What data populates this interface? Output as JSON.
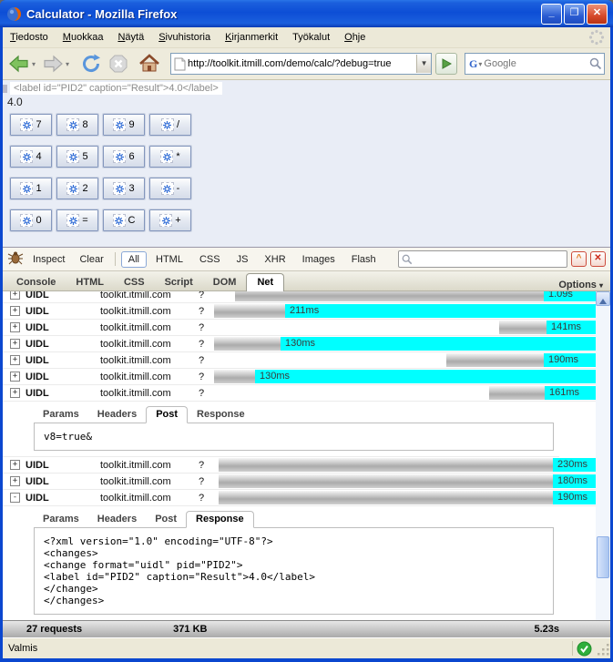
{
  "window": {
    "title": "Calculator - Mozilla Firefox"
  },
  "titlebar_buttons": {
    "minimize": "_",
    "maximize": "□",
    "close": "✕"
  },
  "menu": {
    "items": [
      {
        "label": "Tiedosto",
        "u": "T"
      },
      {
        "label": "Muokkaa",
        "u": "M"
      },
      {
        "label": "Näytä",
        "u": "N"
      },
      {
        "label": "Sivuhistoria",
        "u": "S"
      },
      {
        "label": "Kirjanmerkit",
        "u": "K"
      },
      {
        "label": "Työkalut",
        "u": ""
      },
      {
        "label": "Ohje",
        "u": "O"
      }
    ]
  },
  "toolbar": {
    "url": "http://toolkit.itmill.com/demo/calc/?debug=true",
    "search_placeholder": "Google",
    "search_engine": "G"
  },
  "page": {
    "debug_line": "<label id=\"PID2\" caption=\"Result\">4.0</label>",
    "result": "4.0",
    "calc_buttons": [
      "7",
      "8",
      "9",
      "/",
      "4",
      "5",
      "6",
      "*",
      "1",
      "2",
      "3",
      "-",
      "0",
      "=",
      "C",
      "+"
    ]
  },
  "firebug": {
    "toolbar": {
      "inspect": "Inspect",
      "clear": "Clear",
      "filters": [
        "All",
        "HTML",
        "CSS",
        "JS",
        "XHR",
        "Images",
        "Flash"
      ],
      "active_filter": "All"
    },
    "tabs": [
      "Console",
      "HTML",
      "CSS",
      "Script",
      "DOM",
      "Net"
    ],
    "active_tab": "Net",
    "options_label": "Options",
    "net": {
      "timeline_width": 419,
      "sections": [
        {
          "type": "row",
          "clipped": true,
          "expander": "+",
          "name": "UIDL",
          "domain": "toolkit.itmill.com",
          "path": "?",
          "time": "1.09s",
          "gray_start": 23,
          "gray_end": 362
        },
        {
          "type": "row",
          "expander": "+",
          "name": "UIDL",
          "domain": "toolkit.itmill.com",
          "path": "?",
          "time": "211ms",
          "gray_start": 0,
          "gray_end": 78
        },
        {
          "type": "row",
          "expander": "+",
          "name": "UIDL",
          "domain": "toolkit.itmill.com",
          "path": "?",
          "time": "141ms",
          "gray_start": 313,
          "gray_end": 365
        },
        {
          "type": "row",
          "expander": "+",
          "name": "UIDL",
          "domain": "toolkit.itmill.com",
          "path": "?",
          "time": "130ms",
          "gray_start": 0,
          "gray_end": 73
        },
        {
          "type": "row",
          "expander": "+",
          "name": "UIDL",
          "domain": "toolkit.itmill.com",
          "path": "?",
          "time": "190ms",
          "gray_start": 255,
          "gray_end": 362
        },
        {
          "type": "row",
          "expander": "+",
          "name": "UIDL",
          "domain": "toolkit.itmill.com",
          "path": "?",
          "time": "130ms",
          "gray_start": 0,
          "gray_end": 45
        },
        {
          "type": "row",
          "expander": "+",
          "name": "UIDL",
          "domain": "toolkit.itmill.com",
          "path": "?",
          "time": "161ms",
          "gray_start": 302,
          "gray_end": 363
        },
        {
          "type": "detail",
          "tabs": [
            "Params",
            "Headers",
            "Post",
            "Response"
          ],
          "active": "Post",
          "lines": [
            "v8=true&"
          ]
        },
        {
          "type": "row",
          "expander": "+",
          "name": "UIDL",
          "domain": "toolkit.itmill.com",
          "path": "?",
          "time": "230ms",
          "gray_start": 5,
          "gray_end": 372
        },
        {
          "type": "row",
          "expander": "+",
          "name": "UIDL",
          "domain": "toolkit.itmill.com",
          "path": "?",
          "time": "180ms",
          "gray_start": 5,
          "gray_end": 372
        },
        {
          "type": "row",
          "expander": "-",
          "name": "UIDL",
          "domain": "toolkit.itmill.com",
          "path": "?",
          "time": "190ms",
          "gray_start": 5,
          "gray_end": 372
        },
        {
          "type": "detail",
          "tabs": [
            "Params",
            "Headers",
            "Post",
            "Response"
          ],
          "active": "Response",
          "lines": [
            "<?xml version=\"1.0\" encoding=\"UTF-8\"?>",
            "<changes>",
            "<change format=\"uidl\" pid=\"PID2\">",
            "<label id=\"PID2\" caption=\"Result\">4.0</label>",
            "</change>",
            "</changes>"
          ]
        }
      ],
      "summary": {
        "requests": "27 requests",
        "size": "371 KB",
        "time": "5.23s"
      }
    }
  },
  "statusbar": {
    "text": "Valmis"
  },
  "colors": {
    "bar_cyan": "#00ffff",
    "xp_blue": "#0b47cf",
    "status_green": "#2fae3c",
    "firebug_filter_border": "#8aa8d8"
  }
}
